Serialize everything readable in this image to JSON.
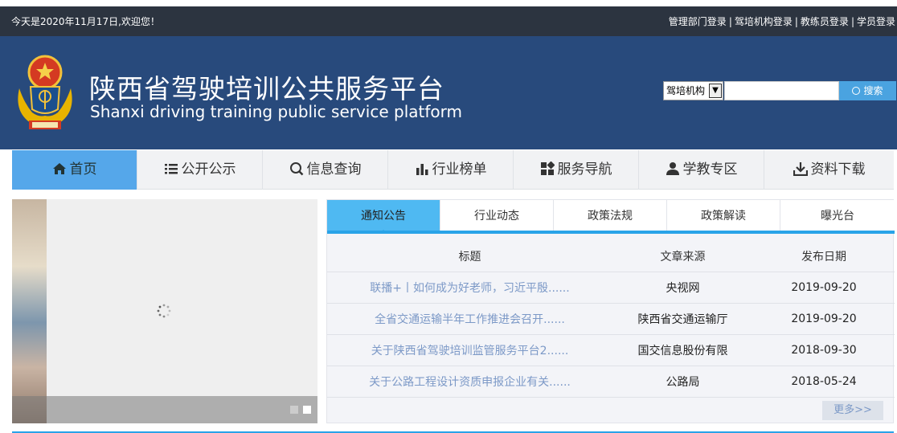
{
  "topbar": {
    "date_text": "今天是2020年11月17日,欢迎您！",
    "logins": [
      "管理部门登录",
      "驾培机构登录",
      "教练员登录",
      "学员登录"
    ],
    "separator": "|"
  },
  "header": {
    "title_cn": "陕西省驾驶培训公共服务平台",
    "title_en": "Shanxi driving training public service platform",
    "emblem_icon": "traffic-police-emblem-icon"
  },
  "search": {
    "selected_option": "驾培机构",
    "input_value": "",
    "button_label": "搜索"
  },
  "nav": {
    "items": [
      {
        "label": "首页",
        "icon": "home-icon"
      },
      {
        "label": "公开公示",
        "icon": "list-icon"
      },
      {
        "label": "信息查询",
        "icon": "search-icon"
      },
      {
        "label": "行业榜单",
        "icon": "bar-chart-icon"
      },
      {
        "label": "服务导航",
        "icon": "grid-icon"
      },
      {
        "label": "学教专区",
        "icon": "user-icon"
      },
      {
        "label": "资料下载",
        "icon": "download-icon"
      }
    ],
    "active_index": 0
  },
  "tabs": {
    "items": [
      "通知公告",
      "行业动态",
      "政策法规",
      "政策解读",
      "曝光台"
    ],
    "active_index": 0
  },
  "news": {
    "headers": [
      "标题",
      "文章来源",
      "发布日期"
    ],
    "rows": [
      {
        "title": "联播+丨如何成为好老师，习近平殷......",
        "source": "央视网",
        "date": "2019-09-20"
      },
      {
        "title": "全省交通运输半年工作推进会召开......",
        "source": "陕西省交通运输厅",
        "date": "2019-09-20"
      },
      {
        "title": "关于陕西省驾驶培训监管服务平台2......",
        "source": "国交信息股份有限",
        "date": "2018-09-30"
      },
      {
        "title": "关于公路工程设计资质申报企业有关......",
        "source": "公路局",
        "date": "2018-05-24"
      }
    ],
    "more_label": "更多>>"
  },
  "colors": {
    "topbar_bg": "#2c3440",
    "header_bg": "#284a7c",
    "nav_active": "#55a7ea",
    "accent": "#29a3e8",
    "link": "#7c99c7"
  }
}
